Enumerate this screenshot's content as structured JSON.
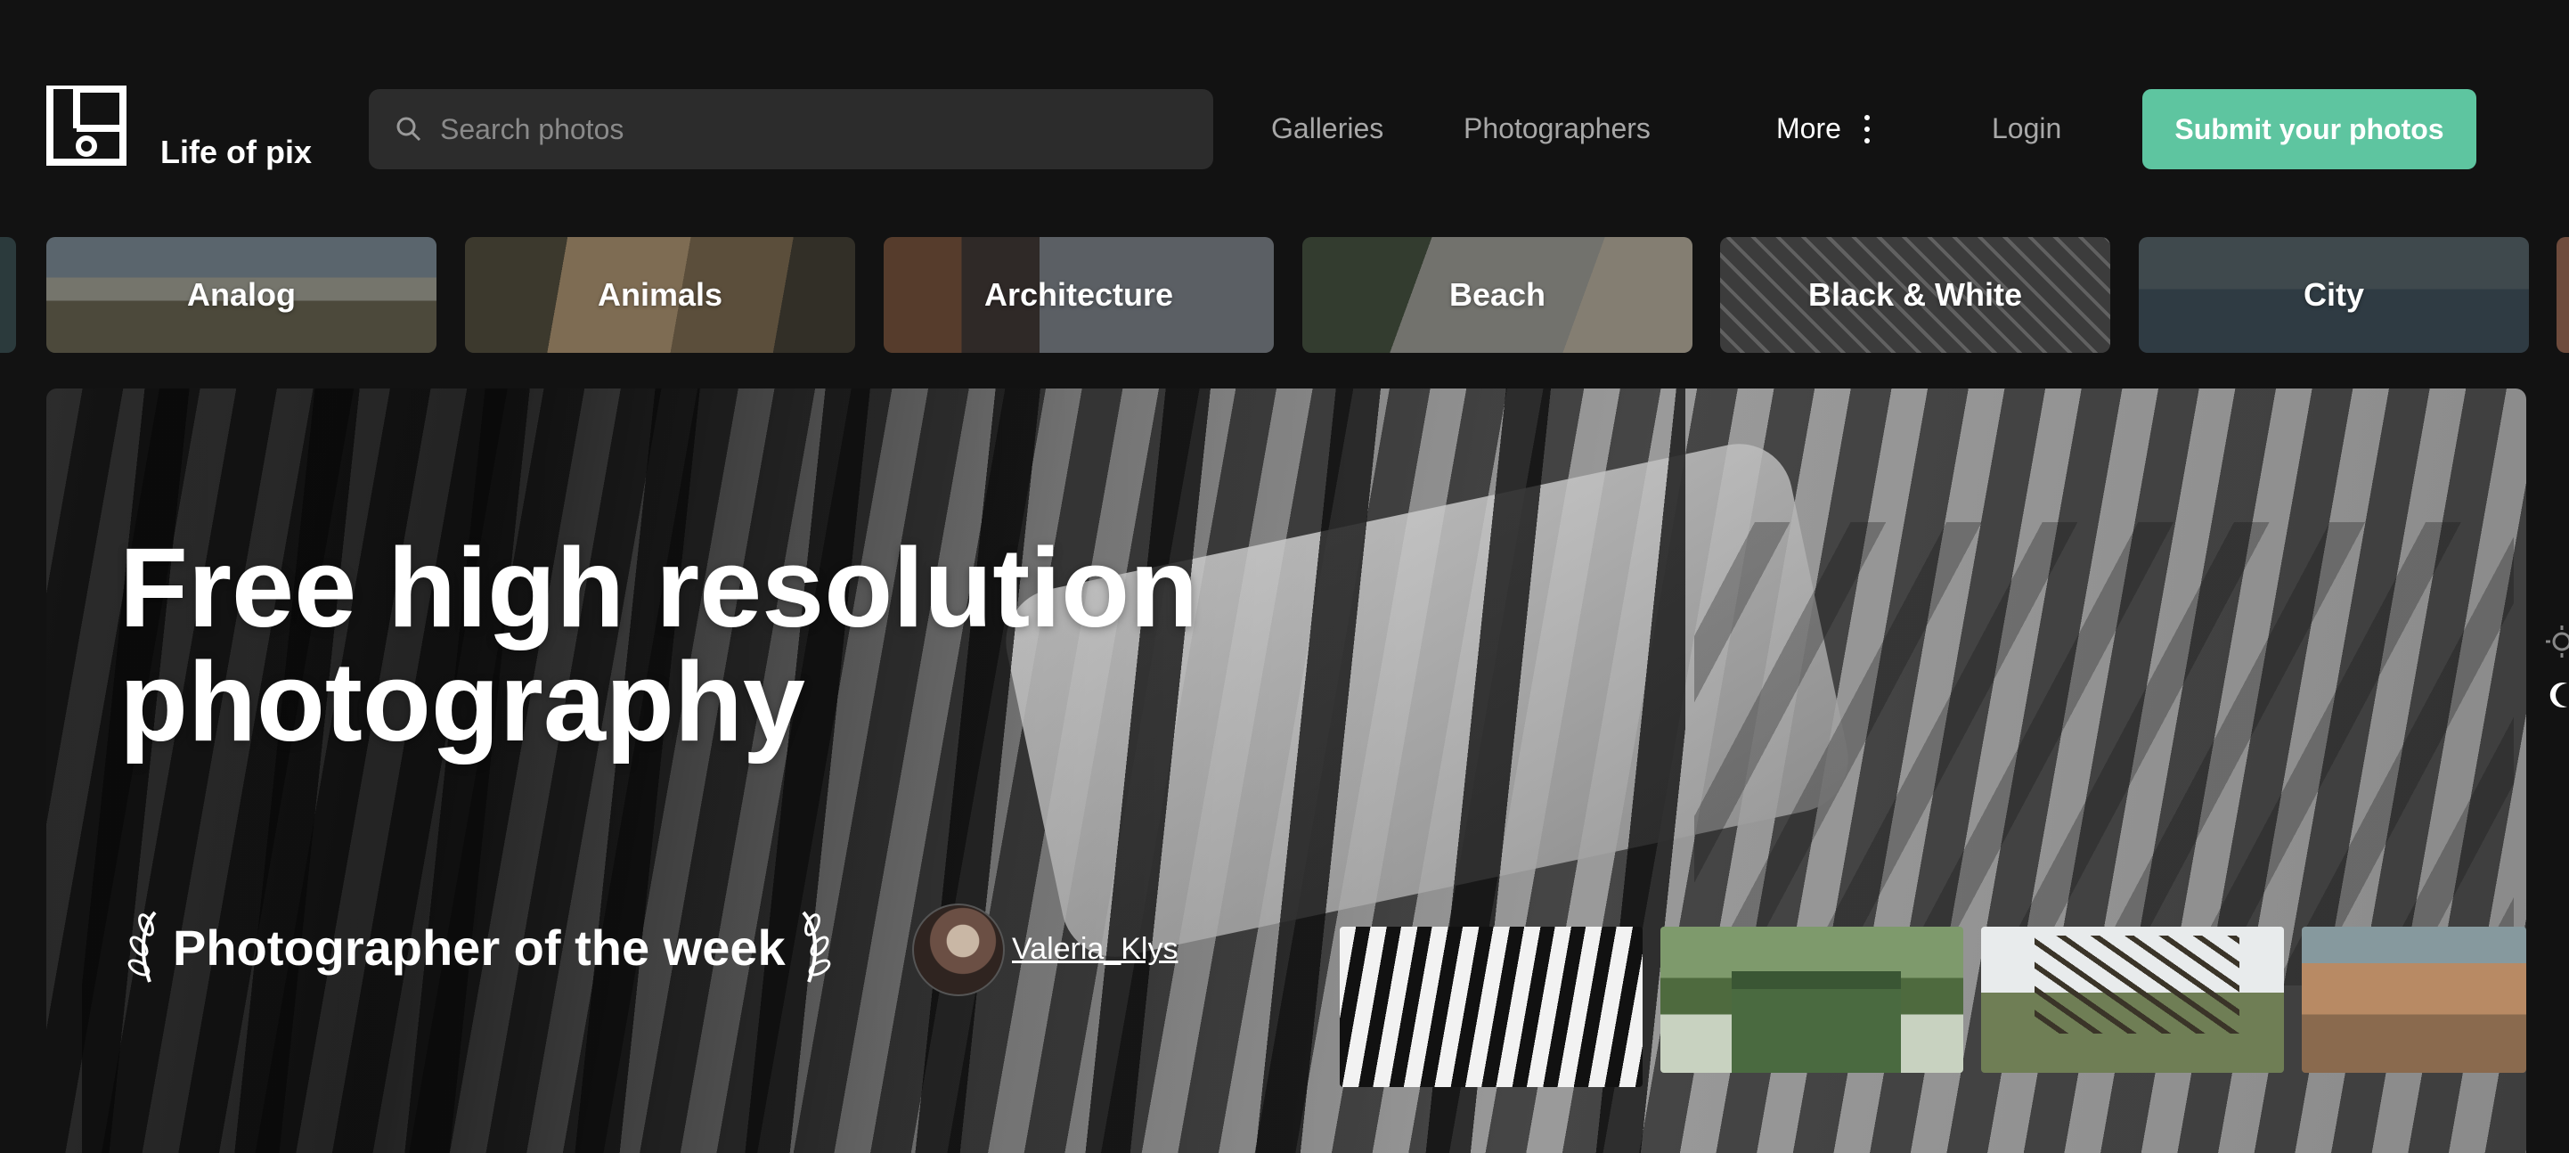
{
  "header": {
    "brand": "Life of pix",
    "search_placeholder": "Search photos",
    "nav": {
      "galleries": "Galleries",
      "photographers": "Photographers",
      "more": "More",
      "login": "Login"
    },
    "submit_label": "Submit your photos",
    "accent_color": "#5ec5a0"
  },
  "categories": [
    {
      "label": "Analog",
      "icon": "analog-thumbnail"
    },
    {
      "label": "Animals",
      "icon": "animals-thumbnail"
    },
    {
      "label": "Architecture",
      "icon": "architecture-thumbnail"
    },
    {
      "label": "Beach",
      "icon": "beach-thumbnail"
    },
    {
      "label": "Black & White",
      "icon": "black-white-thumbnail"
    },
    {
      "label": "City",
      "icon": "city-thumbnail"
    }
  ],
  "hero": {
    "title_line1": "Free high resolution",
    "title_line2": "photography",
    "potw_label": "Photographer of the week",
    "photographer_name": "Valeria_Klys"
  }
}
